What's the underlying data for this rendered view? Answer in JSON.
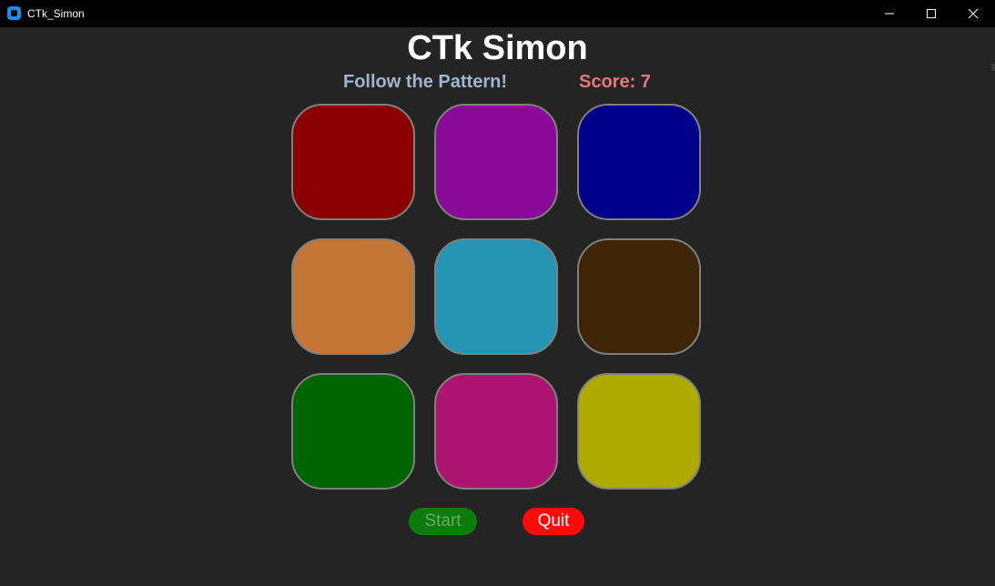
{
  "window": {
    "title": "CTk_Simon"
  },
  "app": {
    "title": "CTk Simon",
    "instruction": "Follow the Pattern!",
    "score_text": "Score: 7"
  },
  "pads": [
    {
      "name": "pad-red",
      "color": "#8b0000"
    },
    {
      "name": "pad-purple",
      "color": "#8b0a97"
    },
    {
      "name": "pad-blue",
      "color": "#00008b"
    },
    {
      "name": "pad-orange",
      "color": "#c27535"
    },
    {
      "name": "pad-cyan",
      "color": "#2494b2"
    },
    {
      "name": "pad-brown",
      "color": "#3e2507"
    },
    {
      "name": "pad-green",
      "color": "#006400"
    },
    {
      "name": "pad-magenta",
      "color": "#ad1370"
    },
    {
      "name": "pad-yellow",
      "color": "#afab02"
    }
  ],
  "buttons": {
    "start_label": "Start",
    "quit_label": "Quit"
  }
}
